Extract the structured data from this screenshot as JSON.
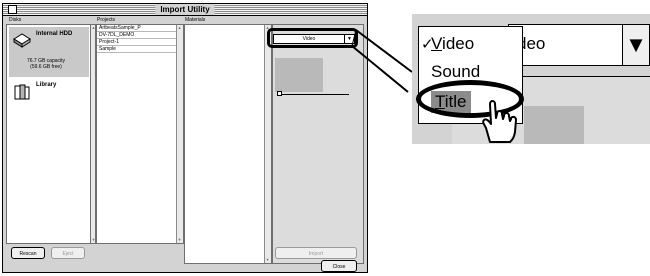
{
  "window": {
    "title": "Import Utility",
    "columns": {
      "disks": "Disks",
      "projects": "Projects",
      "materials": "Materials"
    }
  },
  "disks": [
    {
      "name": "Internal HDD",
      "capacity": "76.7 GB capacity",
      "free": "(59.6 GB free)"
    },
    {
      "name": "Library"
    }
  ],
  "projects": [
    "ArtbeatsSample_P",
    "DV-7DL_DEMO",
    "Project-1",
    "Sample"
  ],
  "buttons": {
    "rescan": "Rescan",
    "eject": "Eject",
    "import": "Import",
    "close": "Close"
  },
  "type_popup": {
    "value": "Video"
  },
  "zoom": {
    "field_text": "deo",
    "menu": [
      {
        "mnemonic": "V",
        "rest": "ideo",
        "checked": true
      },
      {
        "mnemonic": "",
        "rest": "Sound",
        "checked": false
      },
      {
        "mnemonic": "T",
        "rest": "itle",
        "checked": false,
        "highlighted": true
      }
    ],
    "check_glyph": "✓"
  },
  "colors": {
    "window_bg": "#d3d3d3",
    "highlight": "#8b8b8b",
    "border": "#000000"
  }
}
